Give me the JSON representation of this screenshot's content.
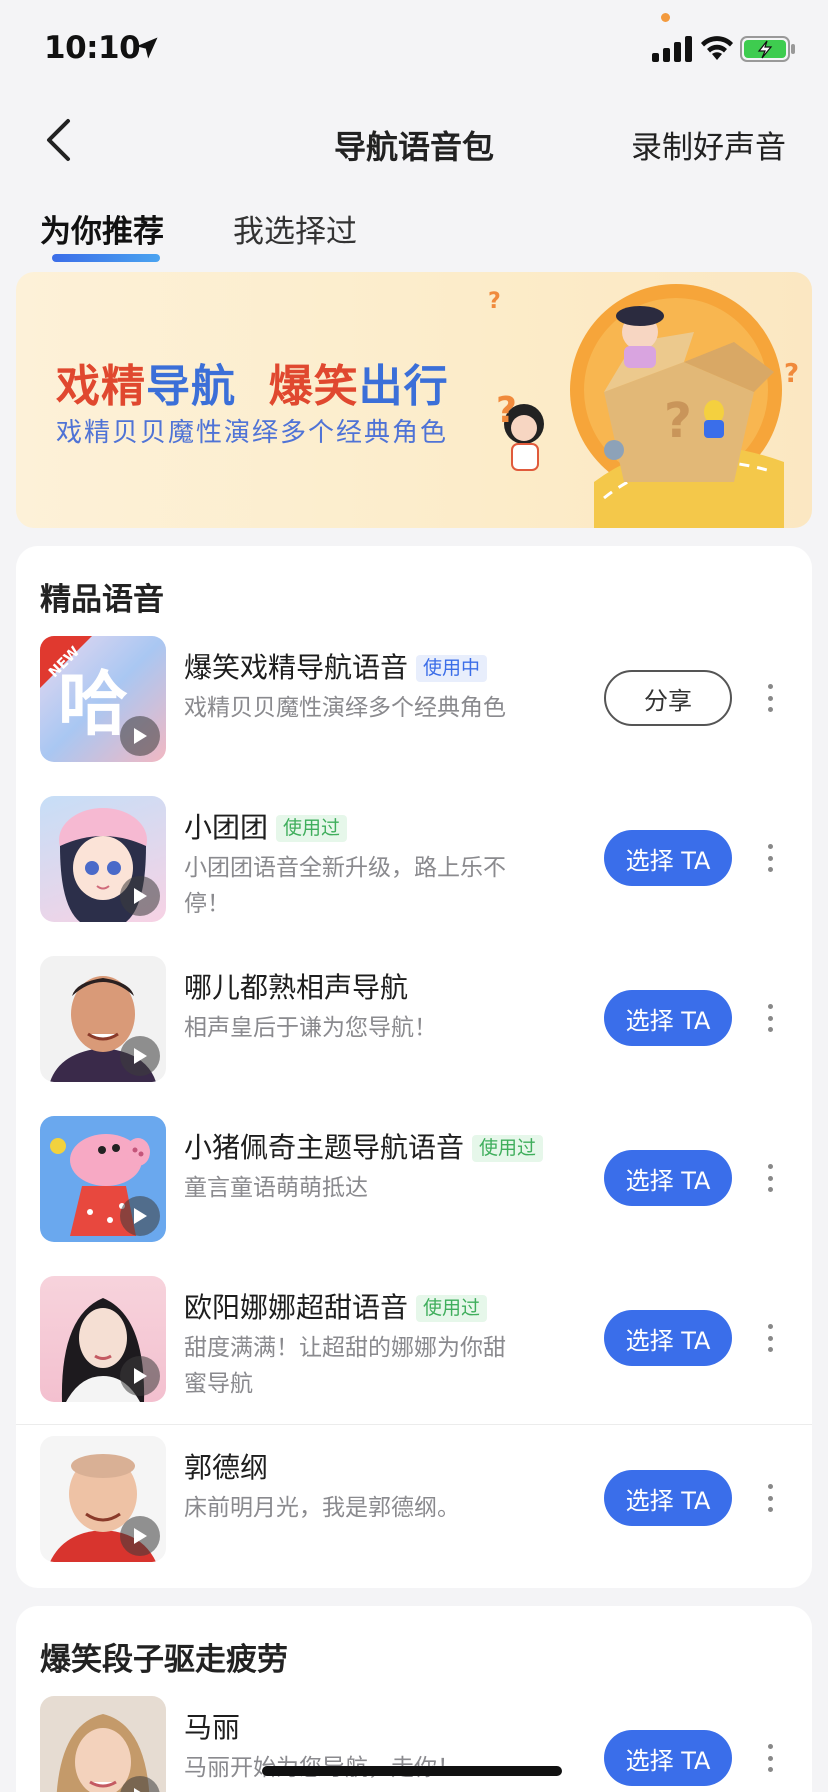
{
  "status": {
    "time": "10:10"
  },
  "nav": {
    "title": "导航语音包",
    "action": "录制好声音"
  },
  "tabs": [
    {
      "label": "为你推荐",
      "active": true
    },
    {
      "label": "我选择过",
      "active": false
    }
  ],
  "banner": {
    "title_parts": [
      "戏精",
      "导航",
      "爆笑",
      "出行"
    ],
    "subtitle": "戏精贝贝魔性演绎多个经典角色"
  },
  "section1": {
    "title": "精品语音",
    "items": [
      {
        "name": "爆笑戏精导航语音",
        "badge": "使用中",
        "desc": "戏精贝贝魔性演绎多个经典角色",
        "button": "分享",
        "thumb_icon": "ha-logo-new-icon"
      },
      {
        "name": "小团团",
        "badge": "使用过",
        "desc": "小团团语音全新升级，路上乐不停！",
        "button": "选择 TA",
        "thumb_icon": "anime-girl-avatar"
      },
      {
        "name": "哪儿都熟相声导航",
        "badge": "",
        "desc": "相声皇后于谦为您导航！",
        "button": "选择 TA",
        "thumb_icon": "man-avatar"
      },
      {
        "name": "小猪佩奇主题导航语音",
        "badge": "使用过",
        "desc": "童言童语萌萌抵达",
        "button": "选择 TA",
        "thumb_icon": "peppa-pig-avatar"
      },
      {
        "name": "欧阳娜娜超甜语音",
        "badge": "使用过",
        "desc": "甜度满满！让超甜的娜娜为你甜蜜导航",
        "button": "选择 TA",
        "thumb_icon": "woman-avatar"
      },
      {
        "name": "郭德纲",
        "badge": "",
        "desc": "床前明月光，我是郭德纲。",
        "button": "选择 TA",
        "thumb_icon": "man-red-avatar"
      }
    ]
  },
  "section2": {
    "title": "爆笑段子驱走疲劳",
    "items": [
      {
        "name": "马丽",
        "badge": "",
        "desc": "马丽开始为您导航，走你！",
        "button": "选择 TA",
        "thumb_icon": "woman-blonde-avatar"
      }
    ]
  },
  "colors": {
    "accent": "#3a6eea",
    "badge_using": "#3b6de8",
    "badge_used": "#3fae5c",
    "banner_red": "#e0482f",
    "banner_blue": "#3b6fd8"
  }
}
